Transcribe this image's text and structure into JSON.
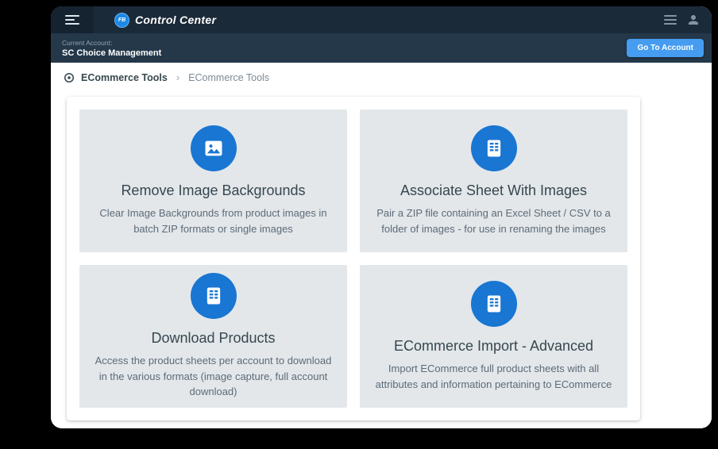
{
  "header": {
    "app_name": "Control Center",
    "logo_text": "FB"
  },
  "account_bar": {
    "label": "Current Account:",
    "account_name": "SC Choice Management",
    "button": "Go To Account"
  },
  "breadcrumb": {
    "root": "ECommerce Tools",
    "separator": "›",
    "current": "ECommerce Tools"
  },
  "tiles": [
    {
      "icon": "image-icon",
      "title": "Remove Image Backgrounds",
      "description": "Clear Image Backgrounds from product images in batch ZIP formats or single images"
    },
    {
      "icon": "spreadsheet-icon",
      "title": "Associate Sheet With Images",
      "description": "Pair a ZIP file containing an Excel Sheet / CSV to a folder of images - for use in renaming the images"
    },
    {
      "icon": "spreadsheet-icon",
      "title": "Download Products",
      "description": "Access the product sheets per account to download in the various formats (image capture, full account download)"
    },
    {
      "icon": "spreadsheet-icon",
      "title": "ECommerce Import - Advanced",
      "description": "Import ECommerce full product sheets with all attributes and information pertaining to ECommerce"
    }
  ],
  "colors": {
    "accent_blue": "#1976d2",
    "button_blue": "#459cf0",
    "topbar_bg": "#1b2a39",
    "account_bar_bg": "#24384a",
    "tile_bg": "#e3e7ea"
  }
}
